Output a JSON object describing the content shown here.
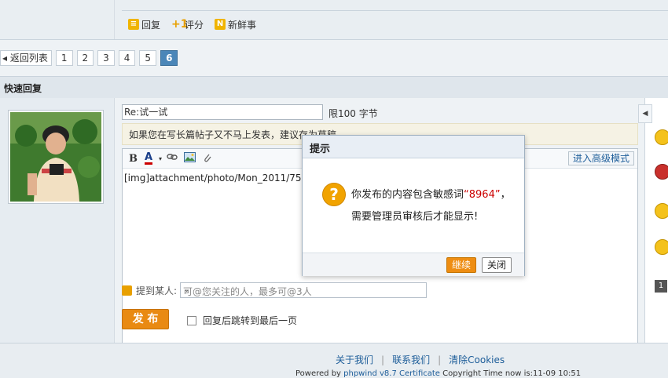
{
  "post_actions": {
    "reply": "回复",
    "rate_icon": "+1",
    "rate": "评分",
    "news_icon": "N",
    "news": "新鲜事"
  },
  "pager": {
    "back": "返回列表",
    "pages": [
      "1",
      "2",
      "3",
      "4",
      "5",
      "6"
    ],
    "current": "6"
  },
  "quick_reply": {
    "title": "快速回复",
    "subject_value": "Re:试一试",
    "limit": "限100 字节",
    "tip": "如果您在写长篇帖子又不马上发表，建议存为草稿",
    "toolbar": {
      "bold": "B",
      "color": "A",
      "advanced_mode": "进入高级模式"
    },
    "editor_content": "[img]attachment/photo/Mon_2011/7549_6165",
    "mention_label": "提到某人:",
    "mention_placeholder": "可@您关注的人，最多可@3人",
    "publish": "发 布",
    "jump_label": "回复后跳转到最后一页"
  },
  "right_panel": {
    "page_number": "1"
  },
  "dialog": {
    "title": "提示",
    "message_prefix": "你发布的内容包含敏感词",
    "keyword": "“8964”",
    "message_suffix": "，",
    "message_line2": "需要管理员审核后才能显示!",
    "continue": "继续",
    "close": "关闭"
  },
  "footer": {
    "links": [
      "关于我们",
      "联系我们",
      "清除Cookies"
    ],
    "powered_prefix": "Powered by ",
    "powered_brand": "phpwind v8.7 Certificate",
    "powered_suffix": " Copyright Time now is:11-09 10:51"
  },
  "colors": {
    "accent_orange": "#e98a12",
    "link_blue": "#1d5d99",
    "keyword_red": "#cc0000"
  }
}
